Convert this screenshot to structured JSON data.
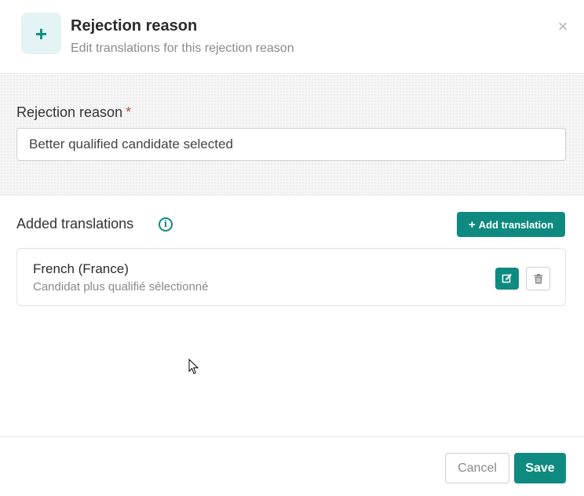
{
  "header": {
    "icon": "plus-icon",
    "icon_glyph": "+",
    "title": "Rejection reason",
    "subtitle": "Edit translations for this rejection reason",
    "close_glyph": "×"
  },
  "reason": {
    "label": "Rejection reason",
    "required_mark": "*",
    "value": "Better qualified candidate selected"
  },
  "translations": {
    "title": "Added translations",
    "info_glyph": "i",
    "add_button": {
      "icon_glyph": "+",
      "label": "Add translation"
    },
    "items": [
      {
        "language": "French (France)",
        "text": "Candidat plus qualifié sélectionné"
      }
    ]
  },
  "footer": {
    "cancel_label": "Cancel",
    "save_label": "Save"
  },
  "colors": {
    "accent": "#0f8a80",
    "required": "#b05a45",
    "icon_bg": "#e4f3f3"
  }
}
